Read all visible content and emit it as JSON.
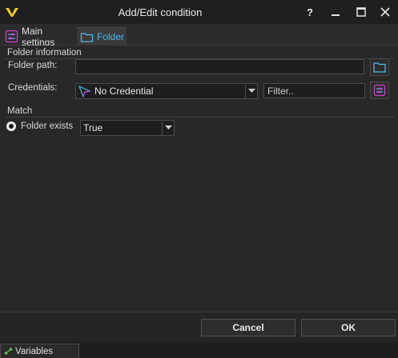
{
  "window": {
    "title": "Add/Edit condition",
    "help_symbol": "?",
    "icons": [
      "app-logo-icon",
      "help-icon",
      "minimize-icon",
      "maximize-icon",
      "close-icon"
    ]
  },
  "tabs": [
    {
      "label": "Main settings",
      "icon": "settings-tab-icon",
      "active": false
    },
    {
      "label": "Folder",
      "icon": "folder-tab-icon",
      "active": true
    }
  ],
  "folder_information": {
    "caption": "Folder information",
    "folder_path_label": "Folder path:",
    "folder_path_value": "",
    "credentials_label": "Credentials:",
    "credential_selected": "No Credential",
    "filter_placeholder": "Filter.."
  },
  "match": {
    "caption": "Match",
    "folder_exists_label": "Folder exists",
    "folder_exists_value": "True"
  },
  "footer": {
    "cancel_label": "Cancel",
    "ok_label": "OK"
  },
  "bottom_bar": {
    "variables_label": "Variables"
  },
  "colors": {
    "accent_blue": "#4fb8e8",
    "accent_magenta": "#d040c8",
    "logo_yellow": "#f0d020"
  }
}
